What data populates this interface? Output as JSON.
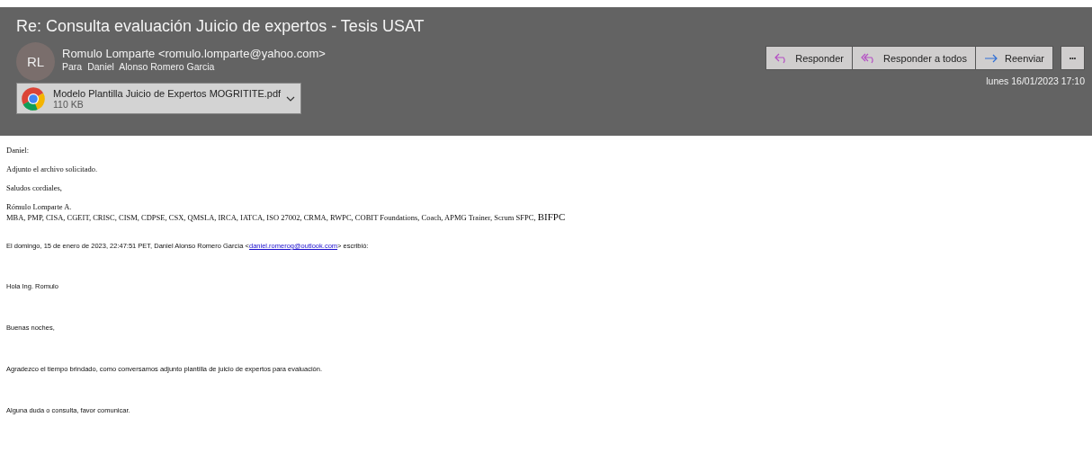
{
  "subject": "Re: Consulta evaluación Juicio de expertos - Tesis USAT",
  "sender": {
    "initials": "RL",
    "name": "Romulo Lomparte <romulo.lomparte@yahoo.com>",
    "to_label": "Para",
    "to": "Daniel  Alonso Romero Garcia"
  },
  "attachment": {
    "name": "Modelo Plantilla Juicio de Expertos MOGRITITE.pdf",
    "size": "110 KB"
  },
  "actions": [
    {
      "kind": "reply",
      "label": "Responder"
    },
    {
      "kind": "reply-all",
      "label": "Responder a todos"
    },
    {
      "kind": "forward",
      "label": "Reenviar"
    }
  ],
  "more": "•••",
  "date": "lunes 16/01/2023 17:10",
  "body": [
    "Daniel:",
    "Adjunto el archivo solicitado.",
    "Saludos cordiales,"
  ],
  "signature": {
    "name": "Rómulo Lomparte A.",
    "credentials": "MBA, PMP, CISA, CGEIT, CRISC, CISM, CDPSE, CSX, QMSLA, IRCA, IATCA, ISO 27002, CRMA, RWPC, COBIT Foundations, Coach, APMG Trainer, Scrum SFPC, ",
    "credentials_tail": "BIFPC"
  },
  "quote": {
    "before": "El domingo, 15 de enero de 2023, 22:47:51 PET, Daniel Alonso Romero Garcìa <",
    "link": "daniel.romerog@outlook.com",
    "after": "> escribió:"
  },
  "quoted_body": [
    "Hola Ing. Romulo",
    "Buenas noches,",
    "Agradezco el tiempo brindado, como conversamos adjunto plantilla de juicio de expertos para evaluación.",
    "Alguna duda o consulta, favor comunicar."
  ]
}
